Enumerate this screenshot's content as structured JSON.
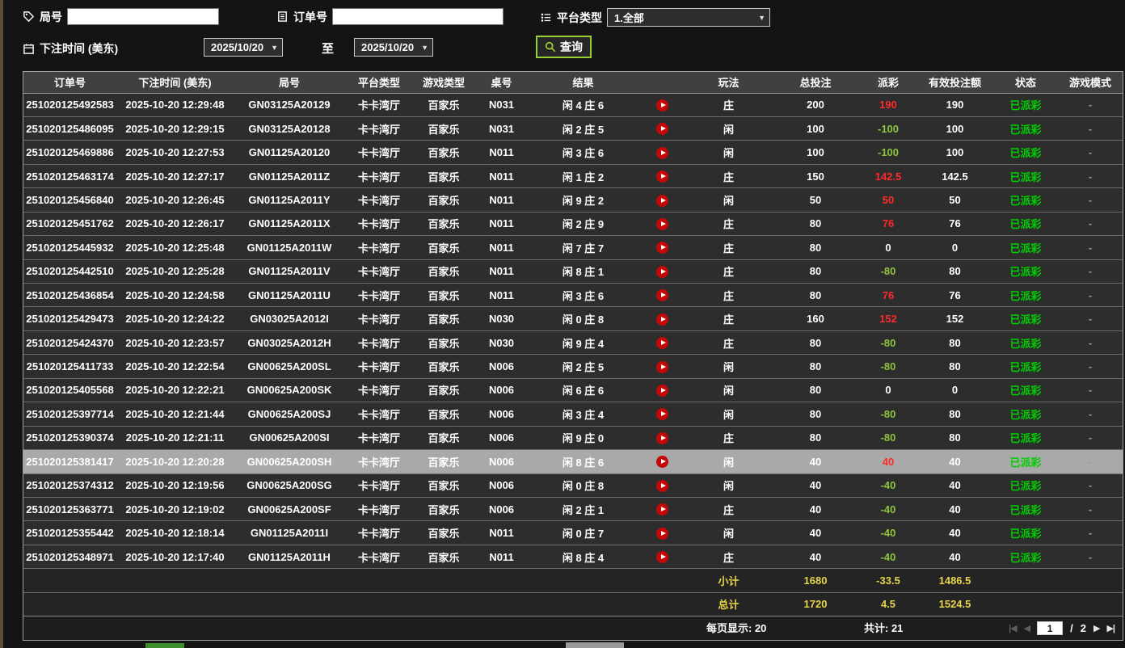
{
  "filters": {
    "round_label": "局号",
    "round_value": "",
    "order_label": "订单号",
    "order_value": "",
    "platform_label": "平台类型",
    "platform_value": "1.全部",
    "bet_time_label": "下注时间 (美东)",
    "date_from": "2025/10/20",
    "to_label": "至",
    "date_to": "2025/10/20",
    "query_label": "查询"
  },
  "table": {
    "headers": [
      "订单号",
      "下注时间 (美东)",
      "局号",
      "平台类型",
      "游戏类型",
      "桌号",
      "结果",
      "",
      "玩法",
      "总投注",
      "派彩",
      "有效投注额",
      "状态",
      "游戏模式"
    ],
    "rows": [
      {
        "order_id": "251020125492583",
        "bet_time": "2025-10-20 12:29:48",
        "round_id": "GN03125A20129",
        "platform": "卡卡湾厅",
        "game_type": "百家乐",
        "table_no": "N031",
        "result": "闲 4 庄 6",
        "play": "庄",
        "total_bet": "200",
        "payout": "190",
        "valid_bet": "190",
        "status": "已派彩",
        "mode": "-"
      },
      {
        "order_id": "251020125486095",
        "bet_time": "2025-10-20 12:29:15",
        "round_id": "GN03125A20128",
        "platform": "卡卡湾厅",
        "game_type": "百家乐",
        "table_no": "N031",
        "result": "闲 2 庄 5",
        "play": "闲",
        "total_bet": "100",
        "payout": "-100",
        "valid_bet": "100",
        "status": "已派彩",
        "mode": "-"
      },
      {
        "order_id": "251020125469886",
        "bet_time": "2025-10-20 12:27:53",
        "round_id": "GN01125A20120",
        "platform": "卡卡湾厅",
        "game_type": "百家乐",
        "table_no": "N011",
        "result": "闲 3 庄 6",
        "play": "闲",
        "total_bet": "100",
        "payout": "-100",
        "valid_bet": "100",
        "status": "已派彩",
        "mode": "-"
      },
      {
        "order_id": "251020125463174",
        "bet_time": "2025-10-20 12:27:17",
        "round_id": "GN01125A2011Z",
        "platform": "卡卡湾厅",
        "game_type": "百家乐",
        "table_no": "N011",
        "result": "闲 1 庄 2",
        "play": "庄",
        "total_bet": "150",
        "payout": "142.5",
        "valid_bet": "142.5",
        "status": "已派彩",
        "mode": "-"
      },
      {
        "order_id": "251020125456840",
        "bet_time": "2025-10-20 12:26:45",
        "round_id": "GN01125A2011Y",
        "platform": "卡卡湾厅",
        "game_type": "百家乐",
        "table_no": "N011",
        "result": "闲 9 庄 2",
        "play": "闲",
        "total_bet": "50",
        "payout": "50",
        "valid_bet": "50",
        "status": "已派彩",
        "mode": "-"
      },
      {
        "order_id": "251020125451762",
        "bet_time": "2025-10-20 12:26:17",
        "round_id": "GN01125A2011X",
        "platform": "卡卡湾厅",
        "game_type": "百家乐",
        "table_no": "N011",
        "result": "闲 2 庄 9",
        "play": "庄",
        "total_bet": "80",
        "payout": "76",
        "valid_bet": "76",
        "status": "已派彩",
        "mode": "-"
      },
      {
        "order_id": "251020125445932",
        "bet_time": "2025-10-20 12:25:48",
        "round_id": "GN01125A2011W",
        "platform": "卡卡湾厅",
        "game_type": "百家乐",
        "table_no": "N011",
        "result": "闲 7 庄 7",
        "play": "庄",
        "total_bet": "80",
        "payout": "0",
        "valid_bet": "0",
        "status": "已派彩",
        "mode": "-"
      },
      {
        "order_id": "251020125442510",
        "bet_time": "2025-10-20 12:25:28",
        "round_id": "GN01125A2011V",
        "platform": "卡卡湾厅",
        "game_type": "百家乐",
        "table_no": "N011",
        "result": "闲 8 庄 1",
        "play": "庄",
        "total_bet": "80",
        "payout": "-80",
        "valid_bet": "80",
        "status": "已派彩",
        "mode": "-"
      },
      {
        "order_id": "251020125436854",
        "bet_time": "2025-10-20 12:24:58",
        "round_id": "GN01125A2011U",
        "platform": "卡卡湾厅",
        "game_type": "百家乐",
        "table_no": "N011",
        "result": "闲 3 庄 6",
        "play": "庄",
        "total_bet": "80",
        "payout": "76",
        "valid_bet": "76",
        "status": "已派彩",
        "mode": "-"
      },
      {
        "order_id": "251020125429473",
        "bet_time": "2025-10-20 12:24:22",
        "round_id": "GN03025A2012I",
        "platform": "卡卡湾厅",
        "game_type": "百家乐",
        "table_no": "N030",
        "result": "闲 0 庄 8",
        "play": "庄",
        "total_bet": "160",
        "payout": "152",
        "valid_bet": "152",
        "status": "已派彩",
        "mode": "-"
      },
      {
        "order_id": "251020125424370",
        "bet_time": "2025-10-20 12:23:57",
        "round_id": "GN03025A2012H",
        "platform": "卡卡湾厅",
        "game_type": "百家乐",
        "table_no": "N030",
        "result": "闲 9 庄 4",
        "play": "庄",
        "total_bet": "80",
        "payout": "-80",
        "valid_bet": "80",
        "status": "已派彩",
        "mode": "-"
      },
      {
        "order_id": "251020125411733",
        "bet_time": "2025-10-20 12:22:54",
        "round_id": "GN00625A200SL",
        "platform": "卡卡湾厅",
        "game_type": "百家乐",
        "table_no": "N006",
        "result": "闲 2 庄 5",
        "play": "闲",
        "total_bet": "80",
        "payout": "-80",
        "valid_bet": "80",
        "status": "已派彩",
        "mode": "-"
      },
      {
        "order_id": "251020125405568",
        "bet_time": "2025-10-20 12:22:21",
        "round_id": "GN00625A200SK",
        "platform": "卡卡湾厅",
        "game_type": "百家乐",
        "table_no": "N006",
        "result": "闲 6 庄 6",
        "play": "闲",
        "total_bet": "80",
        "payout": "0",
        "valid_bet": "0",
        "status": "已派彩",
        "mode": "-"
      },
      {
        "order_id": "251020125397714",
        "bet_time": "2025-10-20 12:21:44",
        "round_id": "GN00625A200SJ",
        "platform": "卡卡湾厅",
        "game_type": "百家乐",
        "table_no": "N006",
        "result": "闲 3 庄 4",
        "play": "闲",
        "total_bet": "80",
        "payout": "-80",
        "valid_bet": "80",
        "status": "已派彩",
        "mode": "-"
      },
      {
        "order_id": "251020125390374",
        "bet_time": "2025-10-20 12:21:11",
        "round_id": "GN00625A200SI",
        "platform": "卡卡湾厅",
        "game_type": "百家乐",
        "table_no": "N006",
        "result": "闲 9 庄 0",
        "play": "庄",
        "total_bet": "80",
        "payout": "-80",
        "valid_bet": "80",
        "status": "已派彩",
        "mode": "-"
      },
      {
        "order_id": "251020125381417",
        "bet_time": "2025-10-20 12:20:28",
        "round_id": "GN00625A200SH",
        "platform": "卡卡湾厅",
        "game_type": "百家乐",
        "table_no": "N006",
        "result": "闲 8 庄 6",
        "play": "闲",
        "total_bet": "40",
        "payout": "40",
        "valid_bet": "40",
        "status": "已派彩",
        "mode": "-",
        "selected": true
      },
      {
        "order_id": "251020125374312",
        "bet_time": "2025-10-20 12:19:56",
        "round_id": "GN00625A200SG",
        "platform": "卡卡湾厅",
        "game_type": "百家乐",
        "table_no": "N006",
        "result": "闲 0 庄 8",
        "play": "闲",
        "total_bet": "40",
        "payout": "-40",
        "valid_bet": "40",
        "status": "已派彩",
        "mode": "-"
      },
      {
        "order_id": "251020125363771",
        "bet_time": "2025-10-20 12:19:02",
        "round_id": "GN00625A200SF",
        "platform": "卡卡湾厅",
        "game_type": "百家乐",
        "table_no": "N006",
        "result": "闲 2 庄 1",
        "play": "庄",
        "total_bet": "40",
        "payout": "-40",
        "valid_bet": "40",
        "status": "已派彩",
        "mode": "-"
      },
      {
        "order_id": "251020125355442",
        "bet_time": "2025-10-20 12:18:14",
        "round_id": "GN01125A2011I",
        "platform": "卡卡湾厅",
        "game_type": "百家乐",
        "table_no": "N011",
        "result": "闲 0 庄 7",
        "play": "闲",
        "total_bet": "40",
        "payout": "-40",
        "valid_bet": "40",
        "status": "已派彩",
        "mode": "-"
      },
      {
        "order_id": "251020125348971",
        "bet_time": "2025-10-20 12:17:40",
        "round_id": "GN01125A2011H",
        "platform": "卡卡湾厅",
        "game_type": "百家乐",
        "table_no": "N011",
        "result": "闲 8 庄 4",
        "play": "庄",
        "total_bet": "40",
        "payout": "-40",
        "valid_bet": "40",
        "status": "已派彩",
        "mode": "-"
      }
    ],
    "subtotal": {
      "label": "小计",
      "total_bet": "1680",
      "payout": "-33.5",
      "valid_bet": "1486.5"
    },
    "total": {
      "label": "总计",
      "total_bet": "1720",
      "payout": "4.5",
      "valid_bet": "1524.5"
    }
  },
  "footer": {
    "per_page": "每页显示: 20",
    "total_count": "共计: 21",
    "current_page": "1",
    "page_sep": "/",
    "total_pages": "2",
    "first_icon": "|◀",
    "prev_icon": "◀",
    "next_icon": "▶",
    "last_icon": "▶|"
  },
  "colors": {
    "page_bg": "#141414",
    "row_bg": "#2d2d2d",
    "header_bg": "#404040",
    "row_border": "#6e6e6e",
    "table_border": "#a0a0a0",
    "selected_bg": "#a9a9a9",
    "payout_win": "#ff2a2a",
    "payout_loss": "#90c53f",
    "payout_zero": "#ffffff",
    "status_paid": "#00cf00",
    "summary_text": "#e6d54a",
    "accent_green": "#9acd32",
    "text": "#ffffff",
    "input_bg": "#ffffff"
  }
}
